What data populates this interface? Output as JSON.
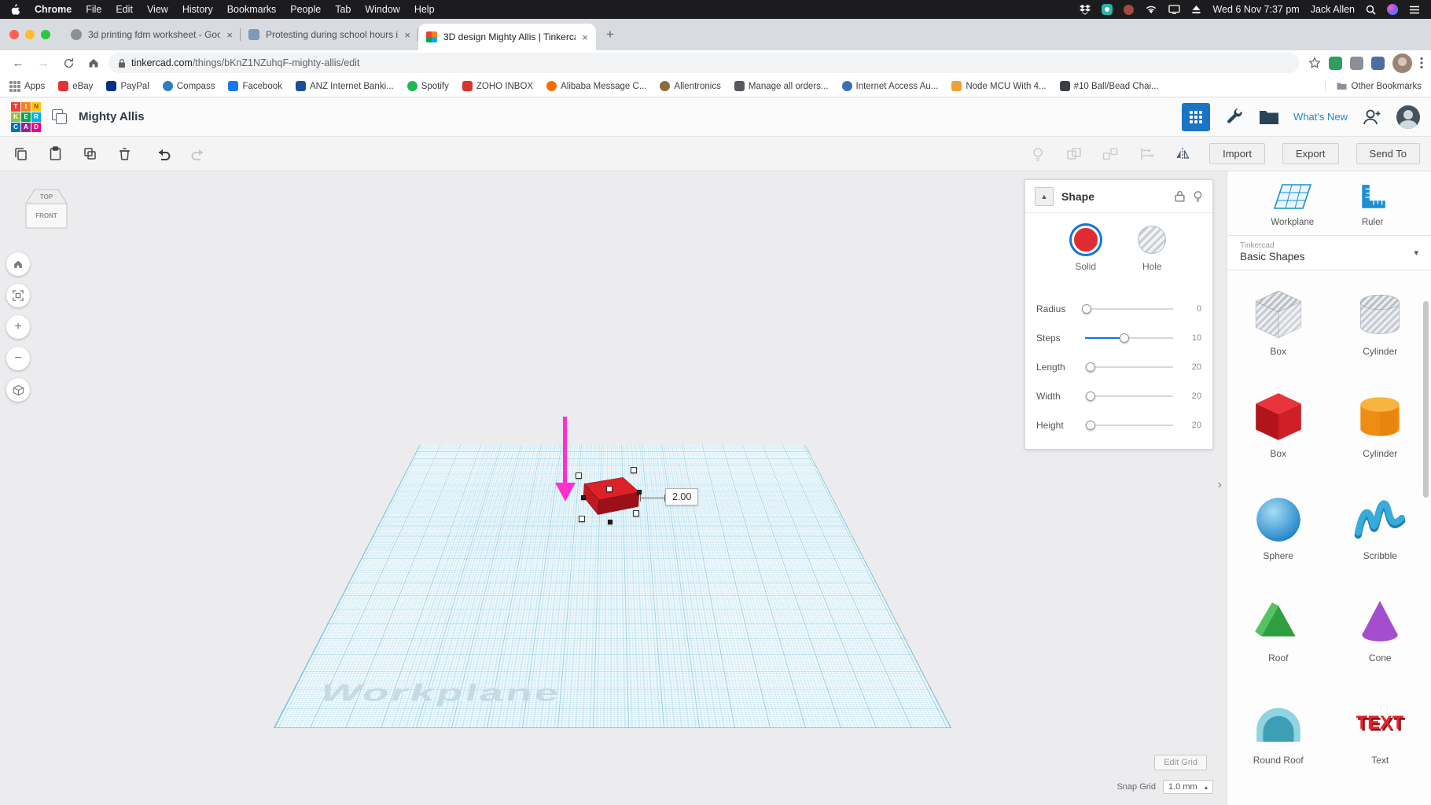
{
  "icons": {
    "back": "←",
    "forward": "→",
    "close": "×",
    "new_tab": "+",
    "caret_down": "▾",
    "chevron_up": "▲",
    "collapse": "›",
    "plus": "+",
    "minus": "−",
    "spin": "▴",
    "kebab": "⋮"
  },
  "menubar": {
    "items": [
      "Chrome",
      "File",
      "Edit",
      "View",
      "History",
      "Bookmarks",
      "People",
      "Tab",
      "Window",
      "Help"
    ],
    "status": {
      "clock": "Wed 6 Nov 7:37 pm",
      "user": "Jack Allen"
    }
  },
  "browser": {
    "tabs": [
      {
        "title": "3d printing fdm worksheet - Goo"
      },
      {
        "title": "Protesting during school hours i"
      },
      {
        "title": "3D design Mighty Allis | Tinkerca",
        "active": true
      }
    ],
    "address": {
      "domain": "tinkercad.com",
      "path": "/things/bKnZ1NZuhqF-mighty-allis/edit"
    },
    "bookmarks": {
      "apps_label": "Apps",
      "items": [
        "eBay",
        "PayPal",
        "Compass",
        "Facebook",
        "ANZ Internet Banki...",
        "Spotify",
        "ZOHO INBOX",
        "Alibaba Message C...",
        "Allentronics",
        "Manage all orders...",
        "Internet Access Au...",
        "Node MCU With 4...",
        "#10 Ball/Bead Chai..."
      ],
      "other": "Other Bookmarks"
    }
  },
  "app": {
    "logo_rows": [
      "TIN",
      "KER",
      "CAD"
    ],
    "title": "Mighty Allis",
    "whats_new": "What's New",
    "toolbar": {
      "import": "Import",
      "export": "Export",
      "send_to": "Send To"
    },
    "viewcube": {
      "top": "TOP",
      "front": "FRONT"
    },
    "viewport": {
      "watermark": "Workplane",
      "dimension": "2.00"
    },
    "inspector": {
      "title": "Shape",
      "solid": "Solid",
      "hole": "Hole",
      "sliders": [
        {
          "label": "Radius",
          "value": "0"
        },
        {
          "label": "Steps",
          "value": "10"
        },
        {
          "label": "Length",
          "value": "20"
        },
        {
          "label": "Width",
          "value": "20"
        },
        {
          "label": "Height",
          "value": "20"
        }
      ]
    },
    "library": {
      "helpers": [
        {
          "label": "Workplane"
        },
        {
          "label": "Ruler"
        }
      ],
      "brand": "Tinkercad",
      "category": "Basic Shapes",
      "shapes": [
        {
          "label": "Box"
        },
        {
          "label": "Cylinder"
        },
        {
          "label": "Box"
        },
        {
          "label": "Cylinder"
        },
        {
          "label": "Sphere"
        },
        {
          "label": "Scribble"
        },
        {
          "label": "Roof"
        },
        {
          "label": "Cone"
        },
        {
          "label": "Round Roof"
        },
        {
          "label": "Text",
          "icon_text": "TEXT"
        }
      ]
    },
    "grid_controls": {
      "edit_grid": "Edit Grid",
      "snap_label": "Snap Grid",
      "snap_value": "1.0 mm"
    }
  },
  "colors": {
    "accent_blue": "#1373D6",
    "solid_red": "#DF2B33",
    "arrow_magenta": "#FF30CF",
    "workplane_line": "#5CAECC",
    "menubar_bg": "#1C1C1E"
  }
}
